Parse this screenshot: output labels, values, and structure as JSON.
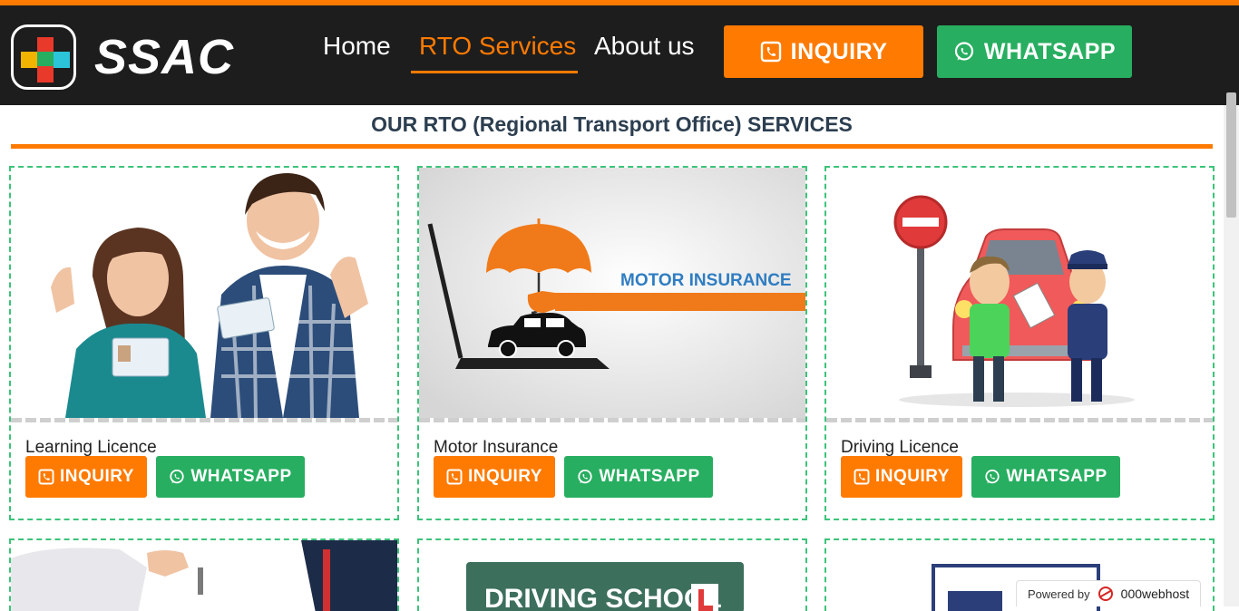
{
  "nav": {
    "logo_text": "SSAC",
    "links": [
      "Home",
      "RTO Services",
      "About us"
    ],
    "inquiry_label": "INQUIRY",
    "whatsapp_label": "WHATSAPP",
    "active_link": "RTO Services"
  },
  "section": {
    "title": "OUR RTO (Regional Transport Office) SERVICES"
  },
  "cards": [
    {
      "title": "Learning Licence",
      "inquiry_label": "INQUIRY",
      "whatsapp_label": "WHATSAPP"
    },
    {
      "title": "Motor Insurance",
      "inquiry_label": "INQUIRY",
      "whatsapp_label": "WHATSAPP",
      "image_text": "MOTOR INSURANCE"
    },
    {
      "title": "Driving Licence",
      "inquiry_label": "INQUIRY",
      "whatsapp_label": "WHATSAPP"
    }
  ],
  "next_row": {
    "image_text": "DRIVING SCHOOL"
  },
  "footer_badge": {
    "prefix": "Powered by",
    "brand": "000webhost"
  },
  "colors": {
    "accent": "#ff7a00",
    "whatsapp": "#27ae60",
    "navbar": "#1d1d1d",
    "card_border": "#3cc37a",
    "title": "#2c3e50"
  },
  "icons": [
    "phone-icon",
    "whatsapp-icon",
    "logo-icon",
    "webhost-icon"
  ]
}
